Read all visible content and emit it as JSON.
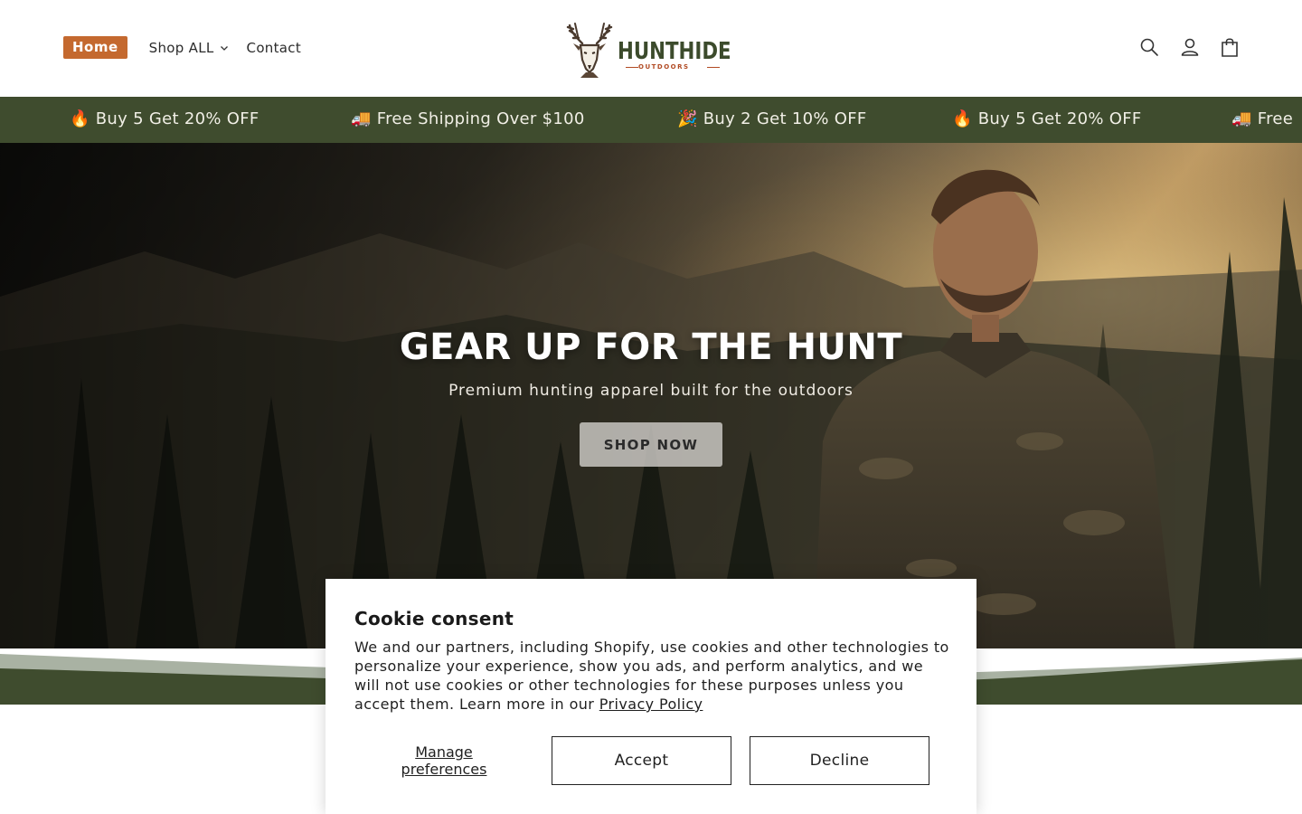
{
  "nav": {
    "home": "Home",
    "shop_all": "Shop ALL",
    "contact": "Contact"
  },
  "logo": {
    "name": "HUNTHIDE",
    "sub": "OUTDOORS"
  },
  "header_icons": [
    "search-icon",
    "account-icon",
    "cart-icon"
  ],
  "announcements": [
    "🔥 Buy 5 Get 20% OFF",
    "🚚 Free Shipping Over $100",
    "🎉 Buy 2 Get 10% OFF",
    "🔥 Buy 5 Get 20% OFF",
    "🚚 Free"
  ],
  "hero": {
    "title": "GEAR UP FOR THE HUNT",
    "subtitle": "Premium hunting apparel built for the outdoors",
    "cta": "SHOP NOW"
  },
  "cookie": {
    "title": "Cookie consent",
    "text": "We and our partners, including Shopify, use cookies and other technologies to personalize your experience, show you ads, and perform analytics, and we will not use cookies or other technologies for these purposes unless you accept them. Learn more in our ",
    "link": "Privacy Policy",
    "manage": "Manage preferences",
    "accept": "Accept",
    "decline": "Decline"
  },
  "colors": {
    "accent": "#c4692f",
    "brand_green": "#3f4c2e",
    "announce_text": "#f1efe6"
  }
}
